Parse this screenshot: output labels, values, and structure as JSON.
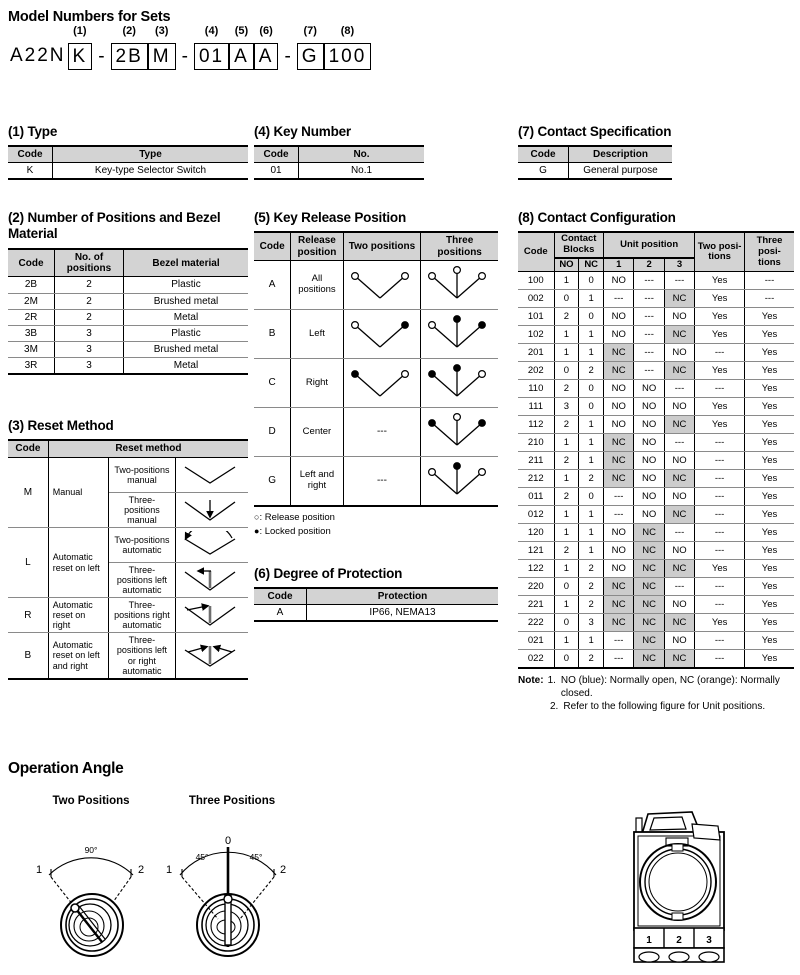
{
  "header": {
    "title": "Model Numbers for Sets",
    "model": {
      "prefix": "A22N",
      "parts": [
        {
          "tag": "(1)",
          "value": "K"
        },
        {
          "tag": "",
          "value": "-",
          "sep": true
        },
        {
          "tag": "(2)",
          "value": "2B"
        },
        {
          "tag": "(3)",
          "value": "M"
        },
        {
          "tag": "",
          "value": "-",
          "sep": true
        },
        {
          "tag": "(4)",
          "value": "01"
        },
        {
          "tag": "(5)",
          "value": "A"
        },
        {
          "tag": "(6)",
          "value": "A"
        },
        {
          "tag": "",
          "value": "-",
          "sep": true
        },
        {
          "tag": "(7)",
          "value": "G"
        },
        {
          "tag": "(8)",
          "value": "100"
        }
      ]
    }
  },
  "sections": {
    "type": {
      "title": "(1) Type",
      "headers": [
        "Code",
        "Type"
      ],
      "rows": [
        [
          "K",
          "Key-type Selector Switch"
        ]
      ]
    },
    "positions": {
      "title": "(2) Number of Positions and Bezel Material",
      "headers": [
        "Code",
        "No. of positions",
        "Bezel material"
      ],
      "rows": [
        [
          "2B",
          "2",
          "Plastic"
        ],
        [
          "2M",
          "2",
          "Brushed metal"
        ],
        [
          "2R",
          "2",
          "Metal"
        ],
        [
          "3B",
          "3",
          "Plastic"
        ],
        [
          "3M",
          "3",
          "Brushed metal"
        ],
        [
          "3R",
          "3",
          "Metal"
        ]
      ]
    },
    "reset": {
      "title": "(3) Reset Method",
      "headers": [
        "Code",
        "Reset method"
      ],
      "rows": [
        {
          "code": "M",
          "mode": "Manual",
          "rowspan": 2,
          "variants": [
            {
              "desc": "Two-positions manual",
              "fig": "two-pos-manual"
            },
            {
              "desc": "Three-positions manual",
              "fig": "three-pos-manual"
            }
          ]
        },
        {
          "code": "L",
          "mode": "Automatic reset on left",
          "rowspan": 2,
          "variants": [
            {
              "desc": "Two-positions automatic",
              "fig": "two-pos-auto"
            },
            {
              "desc": "Three-positions left automatic",
              "fig": "three-pos-left-auto"
            }
          ]
        },
        {
          "code": "R",
          "mode": "Automatic reset on right",
          "rowspan": 1,
          "variants": [
            {
              "desc": "Three-positions right automatic",
              "fig": "three-pos-right-auto"
            }
          ]
        },
        {
          "code": "B",
          "mode": "Automatic reset on left and right",
          "rowspan": 1,
          "variants": [
            {
              "desc": "Three-positions left or right automatic",
              "fig": "three-pos-both-auto"
            }
          ]
        }
      ]
    },
    "keynumber": {
      "title": "(4) Key Number",
      "headers": [
        "Code",
        "No."
      ],
      "rows": [
        [
          "01",
          "No.1"
        ]
      ]
    },
    "keyrelease": {
      "title": "(5) Key Release Position",
      "headers": [
        "Code",
        "Release position",
        "Two positions",
        "Three positions"
      ],
      "rows": [
        {
          "code": "A",
          "release": "All positions",
          "two": "o-o",
          "three": "o-o-o"
        },
        {
          "code": "B",
          "release": "Left",
          "two": "o-x",
          "three": "o-x-x"
        },
        {
          "code": "C",
          "release": "Right",
          "two": "x-o",
          "three": "x-x-o"
        },
        {
          "code": "D",
          "release": "Center",
          "two": "---",
          "three": "x-o-x"
        },
        {
          "code": "G",
          "release": "Left and right",
          "two": "---",
          "three": "o-x-o"
        }
      ],
      "legend": [
        {
          "marker": "open",
          "text": ": Release position"
        },
        {
          "marker": "filled",
          "text": ": Locked position"
        }
      ]
    },
    "protection": {
      "title": "(6) Degree of Protection",
      "headers": [
        "Code",
        "Protection"
      ],
      "rows": [
        [
          "A",
          "IP66, NEMA13"
        ]
      ]
    },
    "contactspec": {
      "title": "(7) Contact Specification",
      "headers": [
        "Code",
        "Description"
      ],
      "rows": [
        [
          "G",
          "General purpose"
        ]
      ]
    },
    "contactconfig": {
      "title": "(8) Contact Configuration",
      "headers": {
        "code": "Code",
        "blocks": "Contact Blocks",
        "no": "NO",
        "nc": "NC",
        "unit": "Unit position",
        "u1": "1",
        "u2": "2",
        "u3": "3",
        "two": "Two posi-tions",
        "three": "Three posi-tions"
      },
      "rows": [
        {
          "code": "100",
          "no": "1",
          "nc": "0",
          "u1": "NO",
          "u2": "---",
          "u3": "---",
          "two": "Yes",
          "three": "---"
        },
        {
          "code": "002",
          "no": "0",
          "nc": "1",
          "u1": "---",
          "u2": "---",
          "u3": "NC",
          "two": "Yes",
          "three": "---"
        },
        {
          "code": "101",
          "no": "2",
          "nc": "0",
          "u1": "NO",
          "u2": "---",
          "u3": "NO",
          "two": "Yes",
          "three": "Yes"
        },
        {
          "code": "102",
          "no": "1",
          "nc": "1",
          "u1": "NO",
          "u2": "---",
          "u3": "NC",
          "two": "Yes",
          "three": "Yes"
        },
        {
          "code": "201",
          "no": "1",
          "nc": "1",
          "u1": "NC",
          "u2": "---",
          "u3": "NO",
          "two": "---",
          "three": "Yes"
        },
        {
          "code": "202",
          "no": "0",
          "nc": "2",
          "u1": "NC",
          "u2": "---",
          "u3": "NC",
          "two": "Yes",
          "three": "Yes"
        },
        {
          "code": "110",
          "no": "2",
          "nc": "0",
          "u1": "NO",
          "u2": "NO",
          "u3": "---",
          "two": "---",
          "three": "Yes"
        },
        {
          "code": "111",
          "no": "3",
          "nc": "0",
          "u1": "NO",
          "u2": "NO",
          "u3": "NO",
          "two": "Yes",
          "three": "Yes"
        },
        {
          "code": "112",
          "no": "2",
          "nc": "1",
          "u1": "NO",
          "u2": "NO",
          "u3": "NC",
          "two": "Yes",
          "three": "Yes"
        },
        {
          "code": "210",
          "no": "1",
          "nc": "1",
          "u1": "NC",
          "u2": "NO",
          "u3": "---",
          "two": "---",
          "three": "Yes"
        },
        {
          "code": "211",
          "no": "2",
          "nc": "1",
          "u1": "NC",
          "u2": "NO",
          "u3": "NO",
          "two": "---",
          "three": "Yes"
        },
        {
          "code": "212",
          "no": "1",
          "nc": "2",
          "u1": "NC",
          "u2": "NO",
          "u3": "NC",
          "two": "---",
          "three": "Yes"
        },
        {
          "code": "011",
          "no": "2",
          "nc": "0",
          "u1": "---",
          "u2": "NO",
          "u3": "NO",
          "two": "---",
          "three": "Yes"
        },
        {
          "code": "012",
          "no": "1",
          "nc": "1",
          "u1": "---",
          "u2": "NO",
          "u3": "NC",
          "two": "---",
          "three": "Yes"
        },
        {
          "code": "120",
          "no": "1",
          "nc": "1",
          "u1": "NO",
          "u2": "NC",
          "u3": "---",
          "two": "---",
          "three": "Yes"
        },
        {
          "code": "121",
          "no": "2",
          "nc": "1",
          "u1": "NO",
          "u2": "NC",
          "u3": "NO",
          "two": "---",
          "three": "Yes"
        },
        {
          "code": "122",
          "no": "1",
          "nc": "2",
          "u1": "NO",
          "u2": "NC",
          "u3": "NC",
          "two": "Yes",
          "three": "Yes"
        },
        {
          "code": "220",
          "no": "0",
          "nc": "2",
          "u1": "NC",
          "u2": "NC",
          "u3": "---",
          "two": "---",
          "three": "Yes"
        },
        {
          "code": "221",
          "no": "1",
          "nc": "2",
          "u1": "NC",
          "u2": "NC",
          "u3": "NO",
          "two": "---",
          "three": "Yes"
        },
        {
          "code": "222",
          "no": "0",
          "nc": "3",
          "u1": "NC",
          "u2": "NC",
          "u3": "NC",
          "two": "Yes",
          "three": "Yes"
        },
        {
          "code": "021",
          "no": "1",
          "nc": "1",
          "u1": "---",
          "u2": "NC",
          "u3": "NO",
          "two": "---",
          "three": "Yes"
        },
        {
          "code": "022",
          "no": "0",
          "nc": "2",
          "u1": "---",
          "u2": "NC",
          "u3": "NC",
          "two": "---",
          "three": "Yes"
        }
      ],
      "note": {
        "label": "Note:",
        "items": [
          {
            "num": "1.",
            "text": "NO (blue): Normally open, NC (orange): Normally closed."
          },
          {
            "num": "2.",
            "text": "Refer to the following figure for Unit positions."
          }
        ]
      }
    },
    "operationangle": {
      "title": "Operation Angle",
      "figures": [
        {
          "label": "Two Positions",
          "angles": [
            "90°"
          ],
          "marks": [
            "1",
            "2"
          ]
        },
        {
          "label": "Three Positions",
          "angles": [
            "45°",
            "45°"
          ],
          "marks": [
            "1",
            "0",
            "2"
          ]
        }
      ]
    },
    "unitfigure": {
      "positions": [
        "1",
        "2",
        "3"
      ]
    }
  },
  "colors": {
    "header_gray": "#d3d3d3",
    "cell_gray": "#cccccc",
    "rule": "#000000"
  }
}
